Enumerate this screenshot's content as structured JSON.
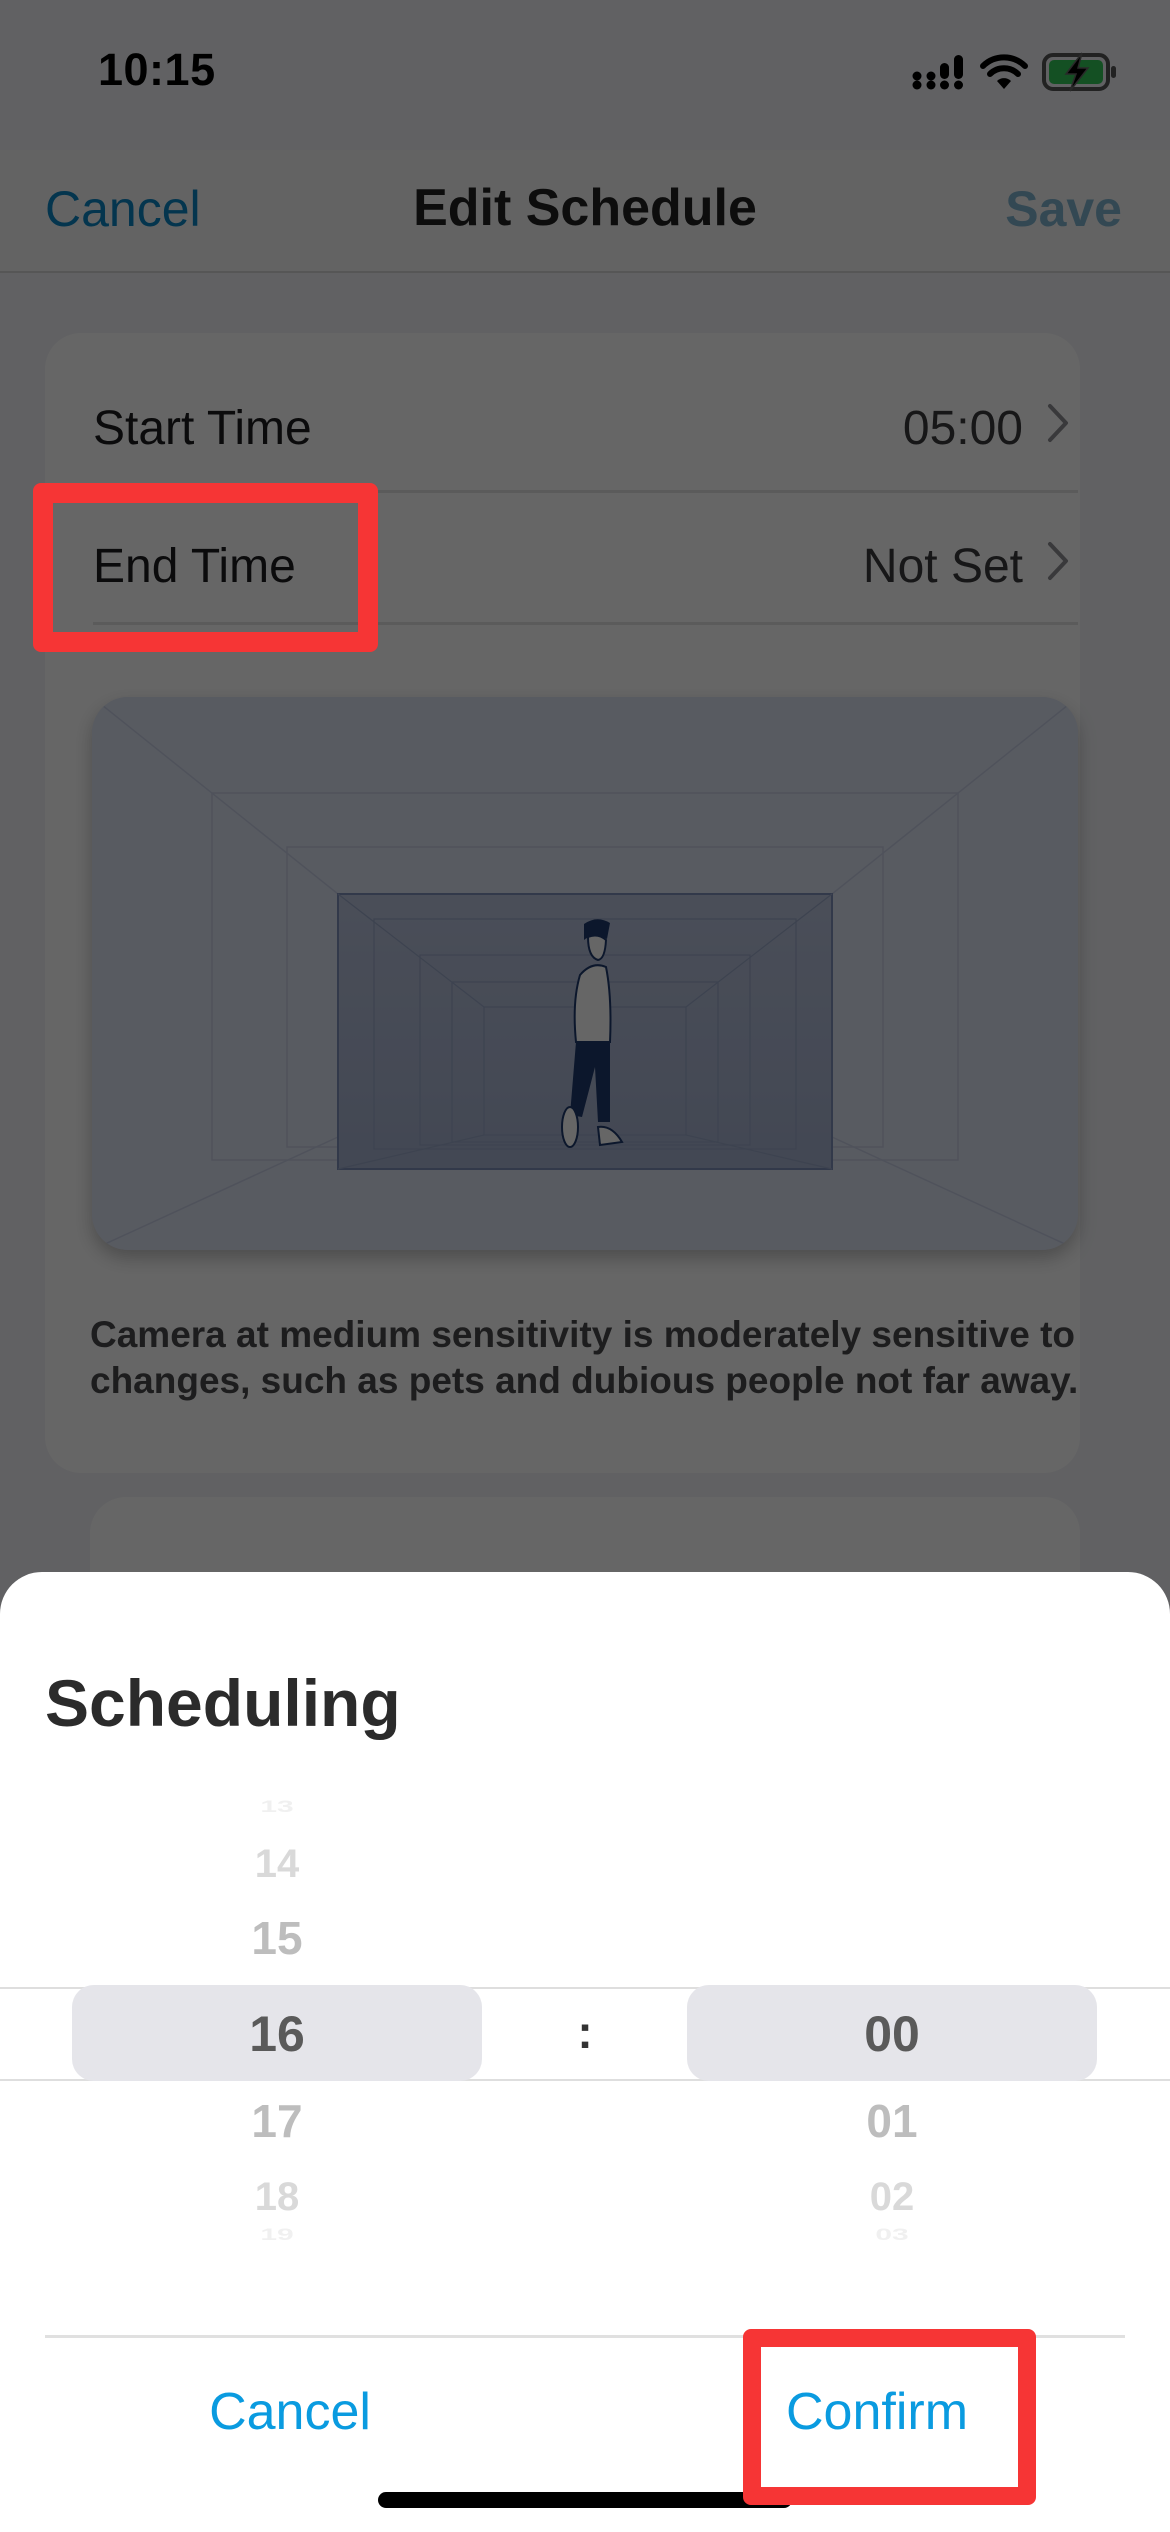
{
  "status_bar": {
    "time": "10:15",
    "icons": [
      "cellular-signal-icon",
      "wifi-icon",
      "battery-charging-icon"
    ],
    "battery_color": "#34c759"
  },
  "navbar": {
    "cancel_label": "Cancel",
    "title": "Edit Schedule",
    "save_label": "Save"
  },
  "schedule": {
    "rows": [
      {
        "label": "Start Time",
        "value": "05:00"
      },
      {
        "label": "End Time",
        "value": "Not Set"
      }
    ],
    "illustration": "person-walking-in-corridor",
    "description": "Camera at medium sensitivity is moderately sensitive to changes, such as pets and dubious people not far away."
  },
  "sheet": {
    "title": "Scheduling",
    "hour_options": [
      "13",
      "14",
      "15",
      "16",
      "17",
      "18",
      "19"
    ],
    "minute_options": [
      "00",
      "01",
      "02",
      "03"
    ],
    "selected_hour": "16",
    "selected_minute": "00",
    "separator": ":",
    "cancel_label": "Cancel",
    "confirm_label": "Confirm",
    "accent_color": "#0a9be0"
  },
  "annotations": {
    "highlight_color": "#f63535",
    "targets": [
      "End Time",
      "Confirm"
    ]
  }
}
